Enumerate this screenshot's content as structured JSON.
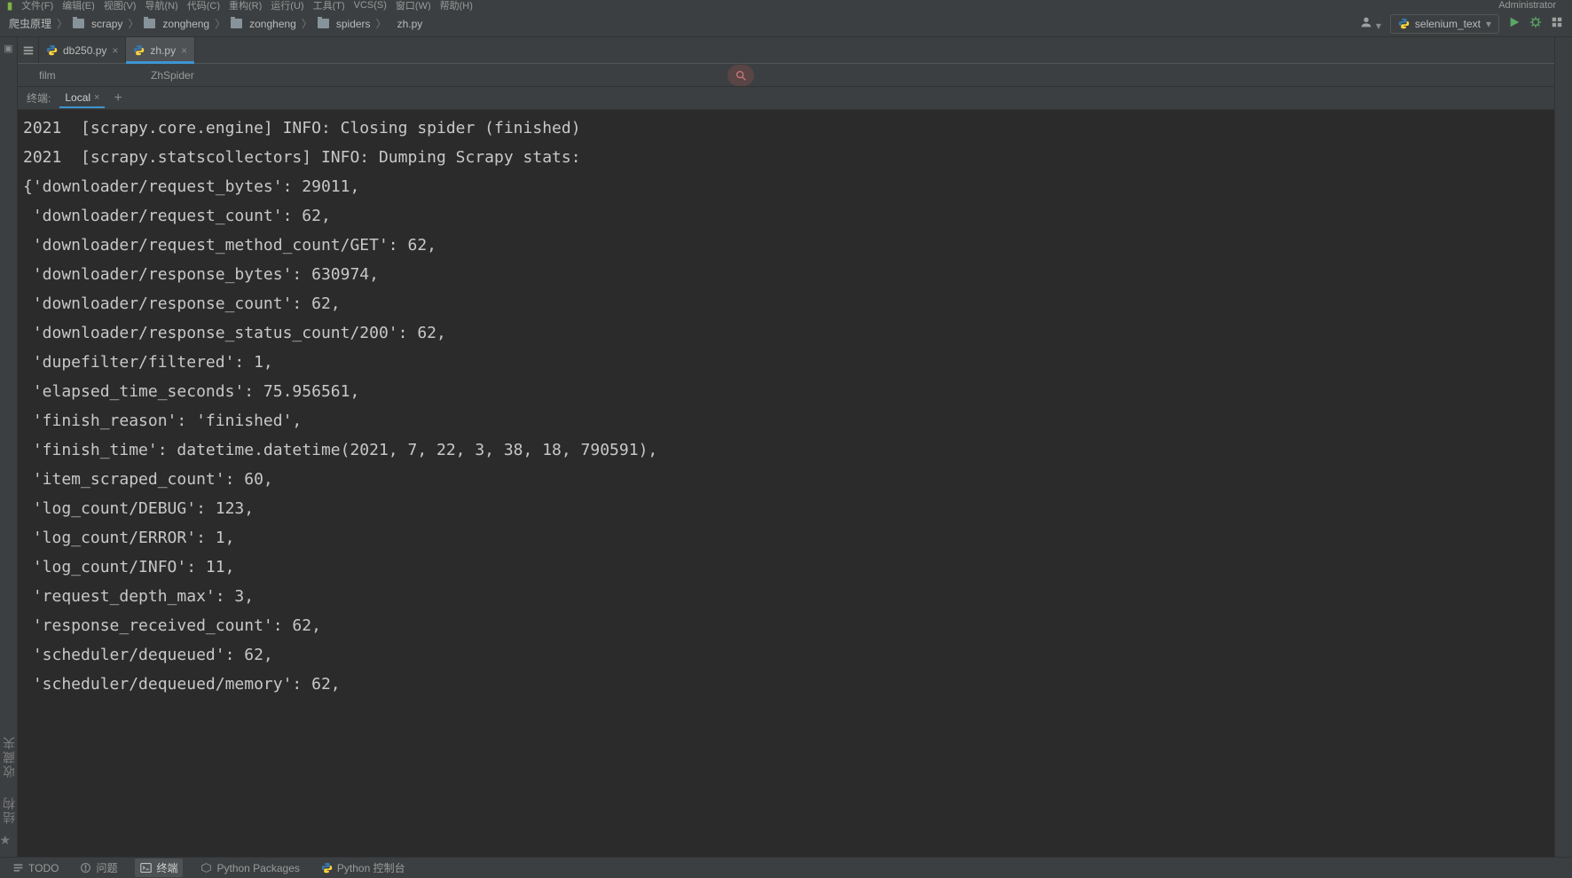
{
  "title_suffix": "Administrator",
  "menubar": {
    "items": [
      "文件(F)",
      "编辑(E)",
      "视图(V)",
      "导航(N)",
      "代码(C)",
      "重构(R)",
      "运行(U)",
      "工具(T)",
      "VCS(S)",
      "窗口(W)",
      "帮助(H)"
    ]
  },
  "breadcrumbs": [
    "爬虫原理",
    "scrapy",
    "zongheng",
    "zongheng",
    "spiders",
    "zh.py"
  ],
  "run_config": "selenium_text",
  "tabs": [
    {
      "name": "db250.py",
      "active": false
    },
    {
      "name": "zh.py",
      "active": true
    }
  ],
  "subheader": {
    "left": "film",
    "class": "ZhSpider"
  },
  "terminal_tabs": {
    "label": "终端:",
    "items": [
      {
        "name": "Local",
        "active": true
      }
    ]
  },
  "terminal_lines": [
    "2021  [scrapy.core.engine] INFO: Closing spider (finished)",
    "2021  [scrapy.statscollectors] INFO: Dumping Scrapy stats:",
    "{'downloader/request_bytes': 29011,",
    " 'downloader/request_count': 62,",
    " 'downloader/request_method_count/GET': 62,",
    " 'downloader/response_bytes': 630974,",
    " 'downloader/response_count': 62,",
    " 'downloader/response_status_count/200': 62,",
    " 'dupefilter/filtered': 1,",
    " 'elapsed_time_seconds': 75.956561,",
    " 'finish_reason': 'finished',",
    " 'finish_time': datetime.datetime(2021, 7, 22, 3, 38, 18, 790591),",
    " 'item_scraped_count': 60,",
    " 'log_count/DEBUG': 123,",
    " 'log_count/ERROR': 1,",
    " 'log_count/INFO': 11,",
    " 'request_depth_max': 3,",
    " 'response_received_count': 62,",
    " 'scheduler/dequeued': 62,",
    " 'scheduler/dequeued/memory': 62,"
  ],
  "left_gutter": {
    "vlabels": [
      "收藏夹",
      "结构"
    ]
  },
  "statusbar": {
    "todo": "TODO",
    "problems": "问题",
    "terminal": "终端",
    "packages": "Python Packages",
    "console": "Python 控制台"
  }
}
